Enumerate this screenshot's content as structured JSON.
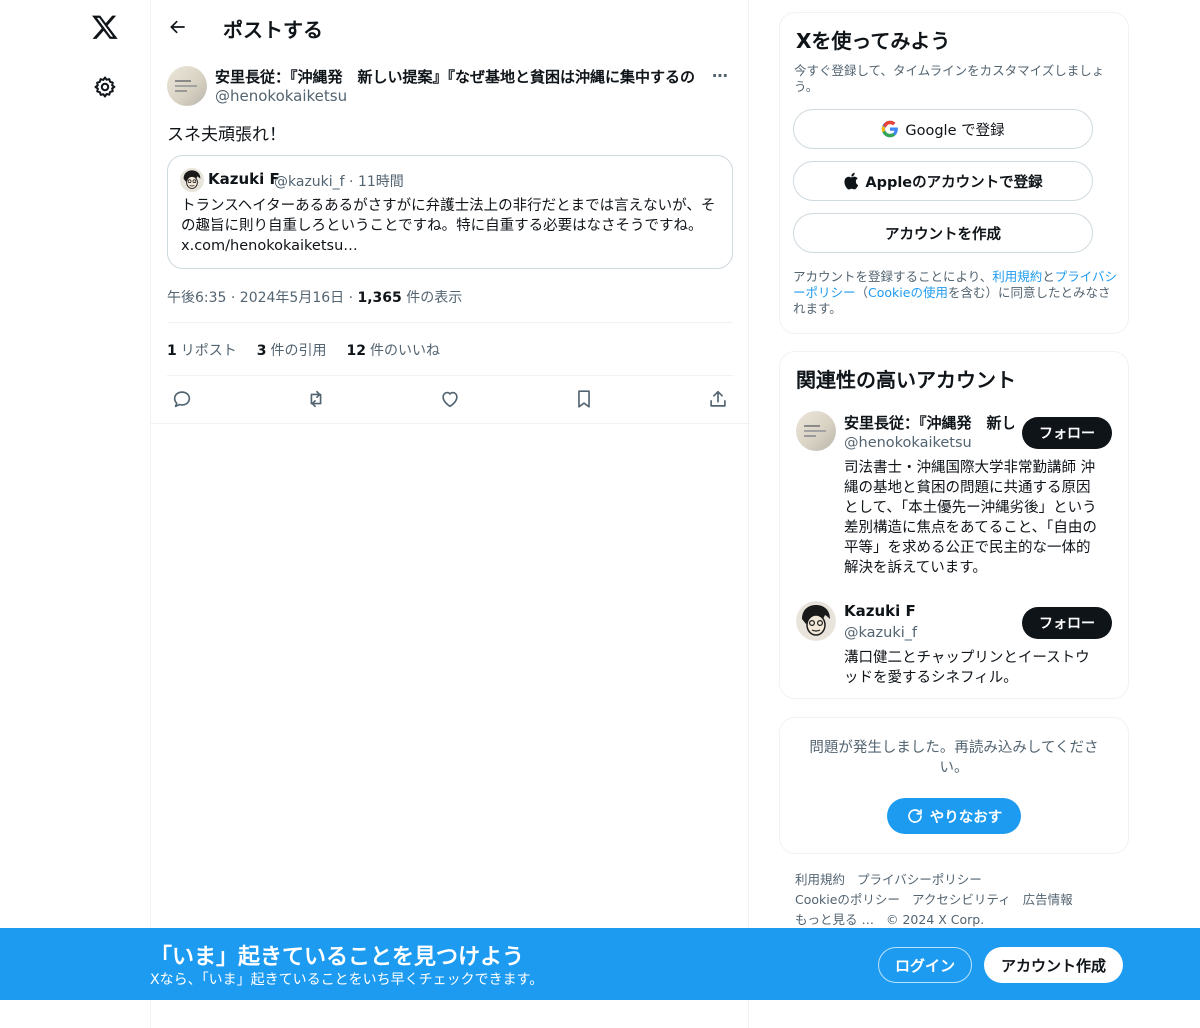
{
  "header": {
    "page_title": "ポストする"
  },
  "post": {
    "author_name": "安里長従：『沖縄発　新しい提案』『なぜ基地と貧困は沖縄に集中するの",
    "author_handle": "@henokokaiketsu",
    "more_label": "⋯",
    "text": "スネ夫頑張れ！",
    "quote": {
      "name": "Kazuki F",
      "meta": "@kazuki_f · 11時間",
      "text": "トランスヘイターあるあるがさすがに弁護士法上の非行だとまでは言えないが、その趣旨に則り自重しろということですね。特に自重する必要はなさそうですね。 x.com/henokokaiketsu…"
    },
    "time": "午後6:35 · 2024年5月16日 · ",
    "views_count": "1,365",
    "views_label": "件の表示",
    "stats": {
      "reposts_count": "1",
      "reposts_label": "リポスト",
      "quotes_count": "3",
      "quotes_label": "件の引用",
      "likes_count": "12",
      "likes_label": "件のいいね"
    }
  },
  "sidebar": {
    "signup": {
      "title": "Xを使ってみよう",
      "subtitle": "今すぐ登録して、タイムラインをカスタマイズしましょう。",
      "google_label": "Google で登録",
      "apple_label": "Appleのアカウントで登録",
      "create_label": "アカウントを作成",
      "legal_1": "アカウントを登録することにより、",
      "legal_terms": "利用規約",
      "legal_2": "と",
      "legal_privacy": "プライバシーポリシー",
      "legal_3": "（",
      "legal_cookie": "Cookieの使用",
      "legal_4": "を含む）に同意したとみなされます。"
    },
    "related": {
      "title": "関連性の高いアカウント",
      "accounts": [
        {
          "name": "安里長従：『沖縄発　新しい提案』",
          "handle": "@henokokaiketsu",
          "follow_label": "フォロー",
          "bio": "司法書士・沖縄国際大学非常勤講師 沖縄の基地と貧困の問題に共通する原因として、「本土優先ー沖縄劣後」という差別構造に焦点をあてること、「自由の平等」を求める公正で民主的な一体的解決を訴えています。"
        },
        {
          "name": "Kazuki F",
          "handle": "@kazuki_f",
          "follow_label": "フォロー",
          "bio": "溝口健二とチャップリンとイーストウッドを愛するシネフィル。"
        }
      ]
    },
    "error": {
      "message": "問題が発生しました。再読み込みしてください。",
      "retry_label": "やりなおす"
    },
    "footer": {
      "links": [
        "利用規約",
        "プライバシーポリシー",
        "Cookieのポリシー",
        "アクセシビリティ",
        "広告情報",
        "もっと見る …"
      ],
      "copyright": "© 2024 X Corp."
    }
  },
  "bottom_bar": {
    "title": "「いま」起きていることを見つけよう",
    "subtitle": "Xなら、「いま」起きていることをいち早くチェックできます。",
    "login_label": "ログイン",
    "signup_label": "アカウント作成"
  },
  "colors": {
    "accent": "#1d9bf0",
    "text": "#0f1419",
    "muted": "#536471",
    "border": "#eff3f4"
  },
  "icons": [
    "x-logo-icon",
    "gear-icon",
    "back-arrow-icon",
    "reply-icon",
    "repost-icon",
    "like-icon",
    "bookmark-icon",
    "share-icon",
    "google-icon",
    "apple-icon",
    "refresh-icon"
  ]
}
